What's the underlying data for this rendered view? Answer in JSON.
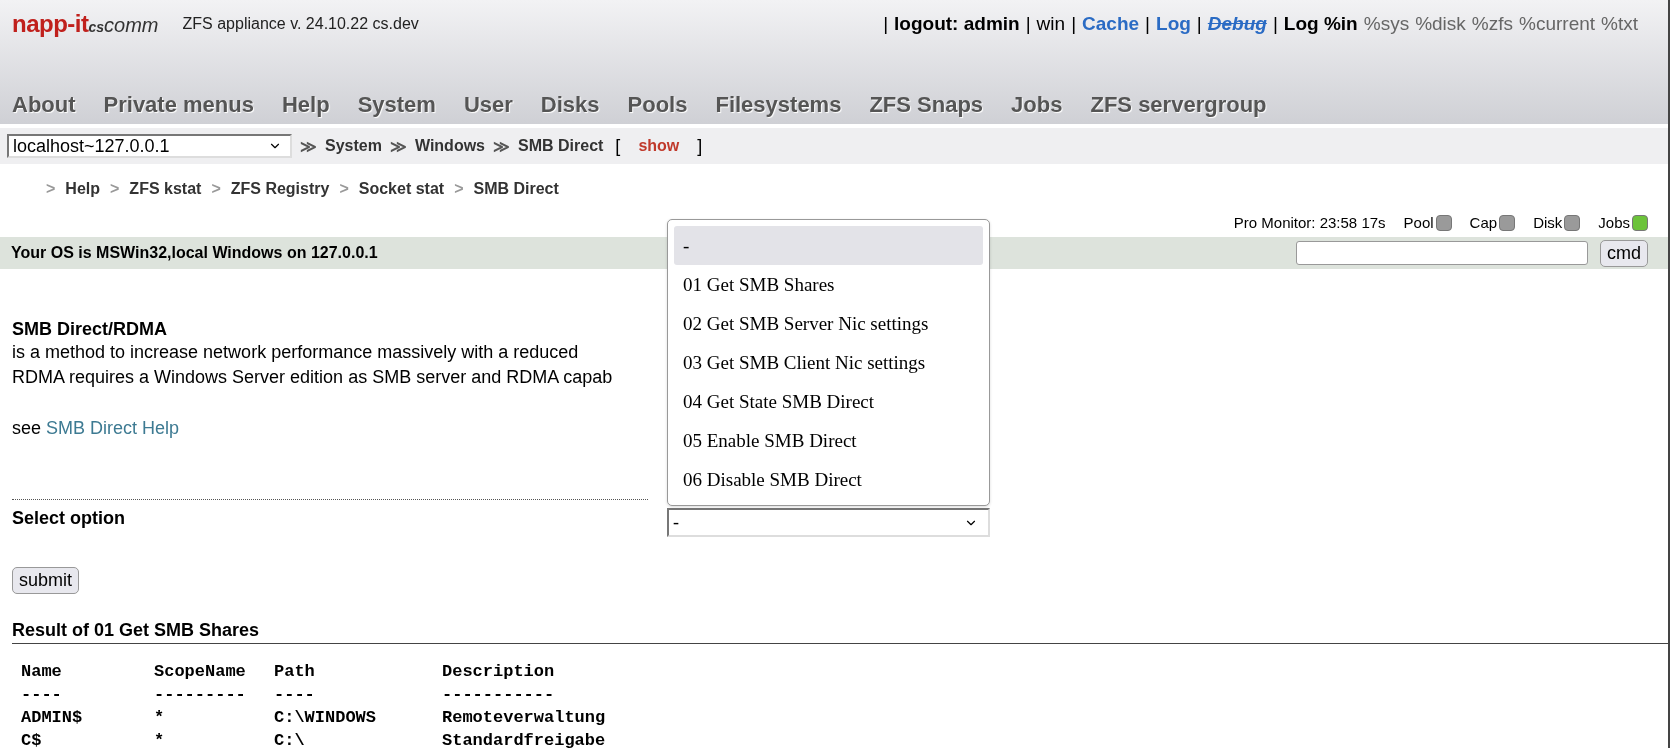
{
  "header": {
    "logo": {
      "main": "napp-it",
      "small": "cs",
      "tail": "comm"
    },
    "version": "ZFS appliance v. 24.10.22 cs.dev",
    "lead_separator": "|",
    "links": [
      {
        "label": "logout: admin",
        "kind": "bold",
        "separator": "|"
      },
      {
        "label": "win",
        "kind": "plain",
        "separator": "|"
      },
      {
        "label": "Cache",
        "kind": "link",
        "separator": "|"
      },
      {
        "label": "Log",
        "kind": "link",
        "separator": "|"
      },
      {
        "label": "Debug",
        "kind": "struck",
        "separator": "|"
      },
      {
        "label": "Log %in",
        "kind": "bold"
      },
      {
        "label": "%sys",
        "kind": "muted"
      },
      {
        "label": "%disk",
        "kind": "muted"
      },
      {
        "label": "%zfs",
        "kind": "muted"
      },
      {
        "label": "%current",
        "kind": "muted"
      },
      {
        "label": "%txt",
        "kind": "muted"
      }
    ],
    "menu": [
      "About",
      "Private menus",
      "Help",
      "System",
      "User",
      "Disks",
      "Pools",
      "Filesystems",
      "ZFS Snaps",
      "Jobs",
      "ZFS servergroup"
    ]
  },
  "host_select": {
    "value": "localhost~127.0.0.1"
  },
  "breadcrumb": {
    "separator": "≫",
    "items": [
      "System",
      "Windows",
      "SMB Direct"
    ],
    "bracket_open": "[",
    "show": "show",
    "bracket_close": "]"
  },
  "submenu": {
    "separator": ">",
    "items": [
      "Help",
      "ZFS kstat",
      "ZFS Registry",
      "Socket stat",
      "SMB Direct"
    ]
  },
  "monitor": {
    "label": "Pro Monitor: 23:58 17s",
    "indicators": [
      {
        "label": "Pool",
        "color": "#9a9a9a"
      },
      {
        "label": "Cap",
        "color": "#9a9a9a"
      },
      {
        "label": "Disk",
        "color": "#9a9a9a"
      },
      {
        "label": "Jobs",
        "color": "#6cc33a"
      }
    ]
  },
  "os_bar": {
    "text": "Your OS is MSWin32,local Windows on 127.0.0.1",
    "cmd_button": "cmd"
  },
  "intro": {
    "title": "SMB Direct/RDMA",
    "lines": [
      "is a method to increase network performance massively with a reduced",
      "RDMA requires a Windows Server edition as SMB server and RDMA capab"
    ],
    "see": "see",
    "help_link": "SMB Direct Help"
  },
  "form": {
    "label": "Select option",
    "value": "-",
    "options": [
      {
        "label": "-",
        "selected": true
      },
      {
        "label": "01 Get SMB Shares",
        "selected": false
      },
      {
        "label": "02 Get SMB Server Nic settings",
        "selected": false
      },
      {
        "label": "03 Get SMB Client Nic settings",
        "selected": false
      },
      {
        "label": "04 Get State SMB Direct",
        "selected": false
      },
      {
        "label": "05 Enable SMB Direct",
        "selected": false
      },
      {
        "label": "06 Disable SMB Direct",
        "selected": false
      }
    ],
    "submit": "submit"
  },
  "result": {
    "title": "Result of 01 Get SMB Shares",
    "table": {
      "columns": [
        "Name",
        "ScopeName",
        "Path",
        "Description"
      ],
      "underlines": [
        "----",
        "---------",
        "----",
        "-----------"
      ],
      "rows": [
        [
          "ADMIN$",
          "*",
          "C:\\WINDOWS",
          "Remoteverwaltung"
        ],
        [
          "C$",
          "*",
          "C:\\",
          "Standardfreigabe"
        ]
      ]
    }
  }
}
